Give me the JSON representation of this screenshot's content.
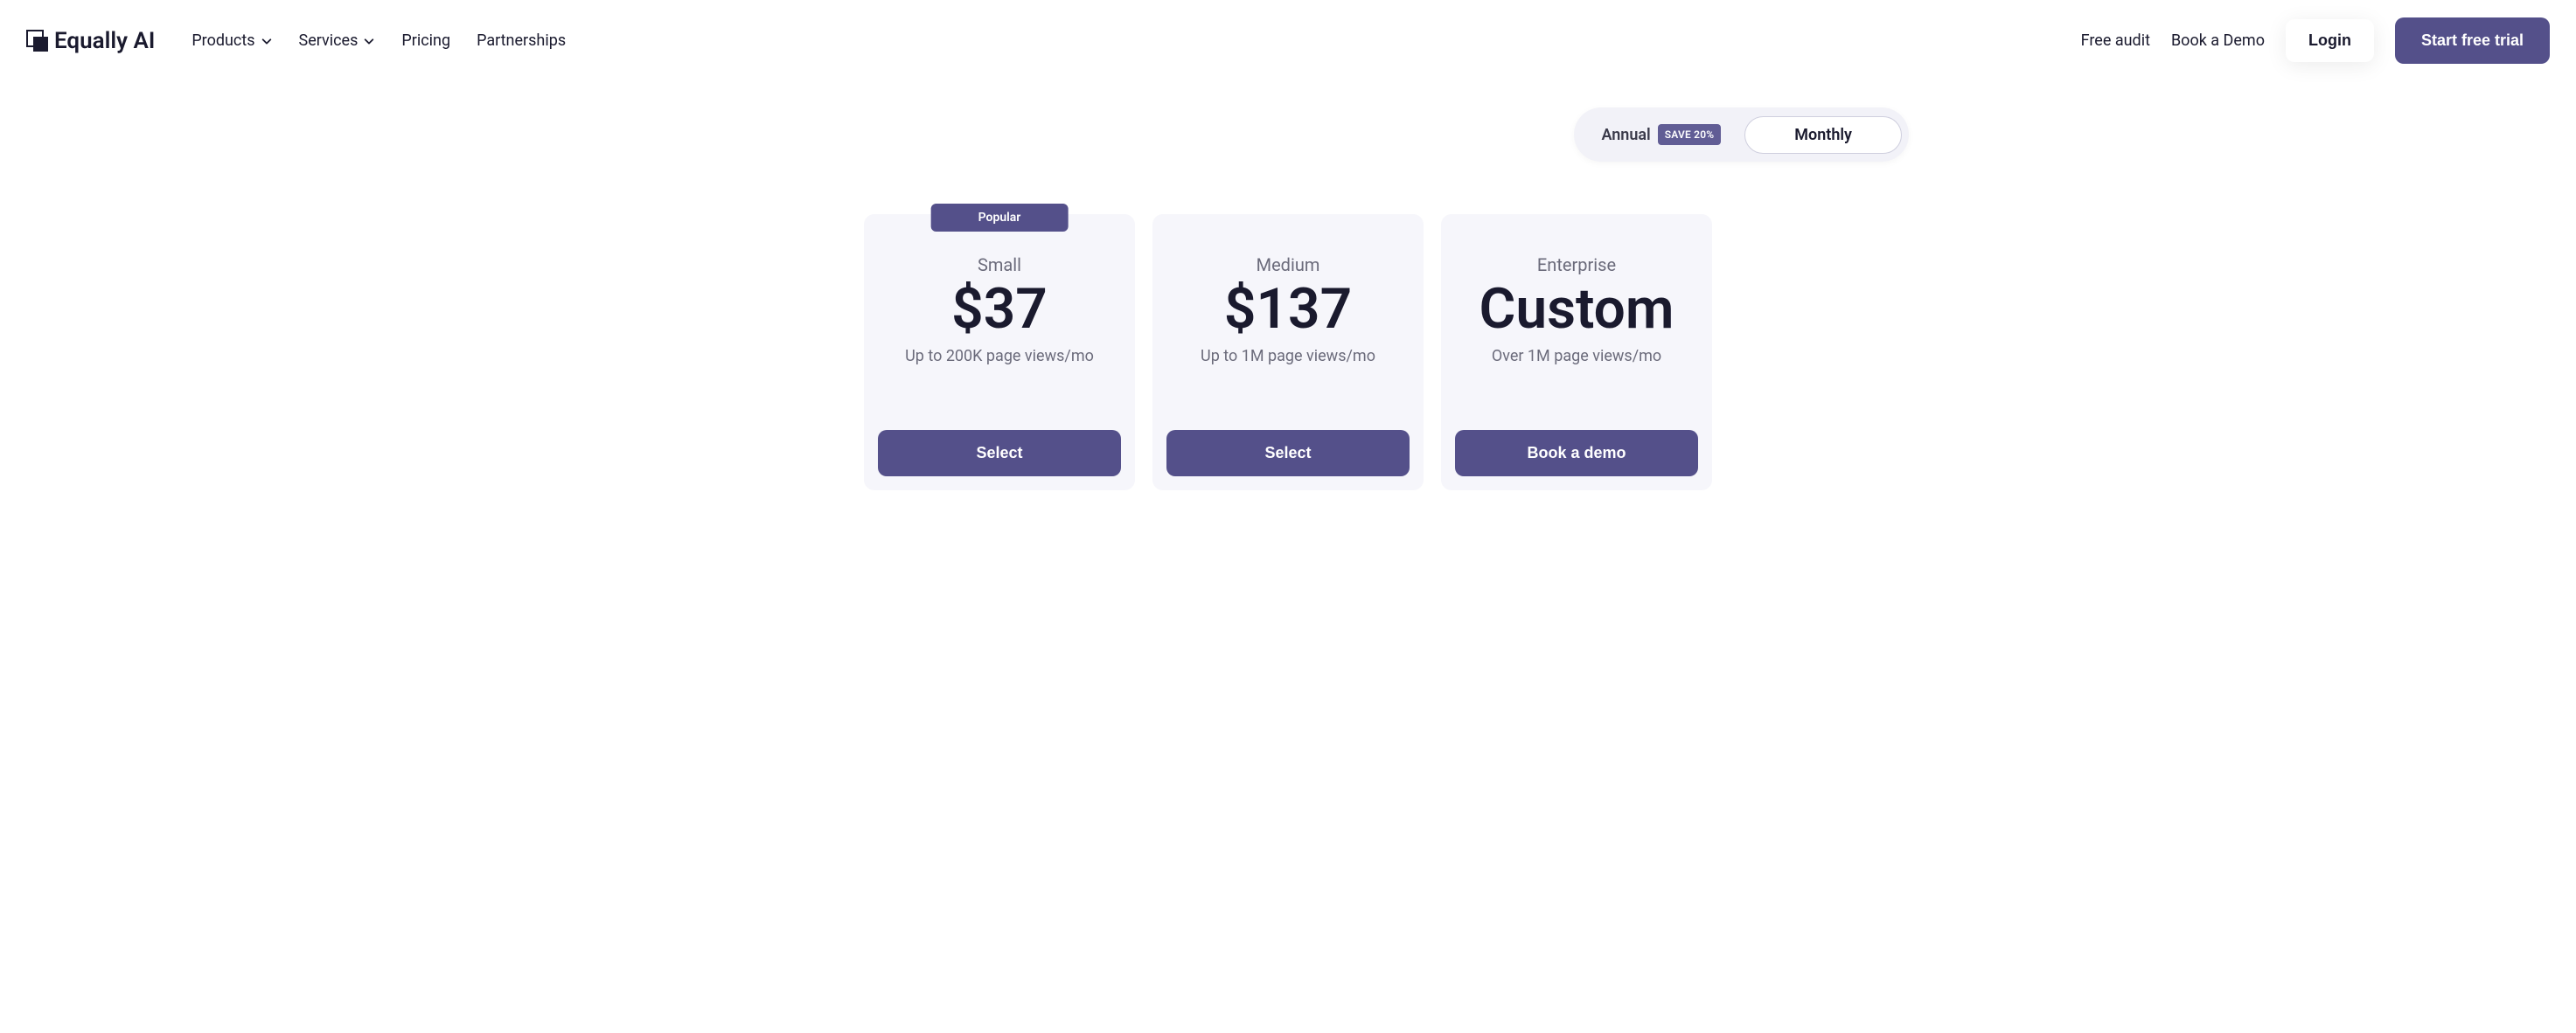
{
  "brand": "Equally AI",
  "nav": {
    "products": "Products",
    "services": "Services",
    "pricing": "Pricing",
    "partnerships": "Partnerships",
    "free_audit": "Free audit",
    "book_demo": "Book a Demo",
    "login": "Login",
    "start_trial": "Start free trial"
  },
  "toggle": {
    "annual": "Annual",
    "save_badge": "SAVE 20%",
    "monthly": "Monthly",
    "active": "monthly"
  },
  "plans": [
    {
      "popular": true,
      "popular_label": "Popular",
      "name": "Small",
      "price": "$37",
      "desc": "Up to 200K page views/mo",
      "cta": "Select"
    },
    {
      "popular": false,
      "name": "Medium",
      "price": "$137",
      "desc": "Up to 1M page views/mo",
      "cta": "Select"
    },
    {
      "popular": false,
      "name": "Enterprise",
      "price": "Custom",
      "desc": "Over 1M page views/mo",
      "cta": "Book a demo"
    }
  ]
}
